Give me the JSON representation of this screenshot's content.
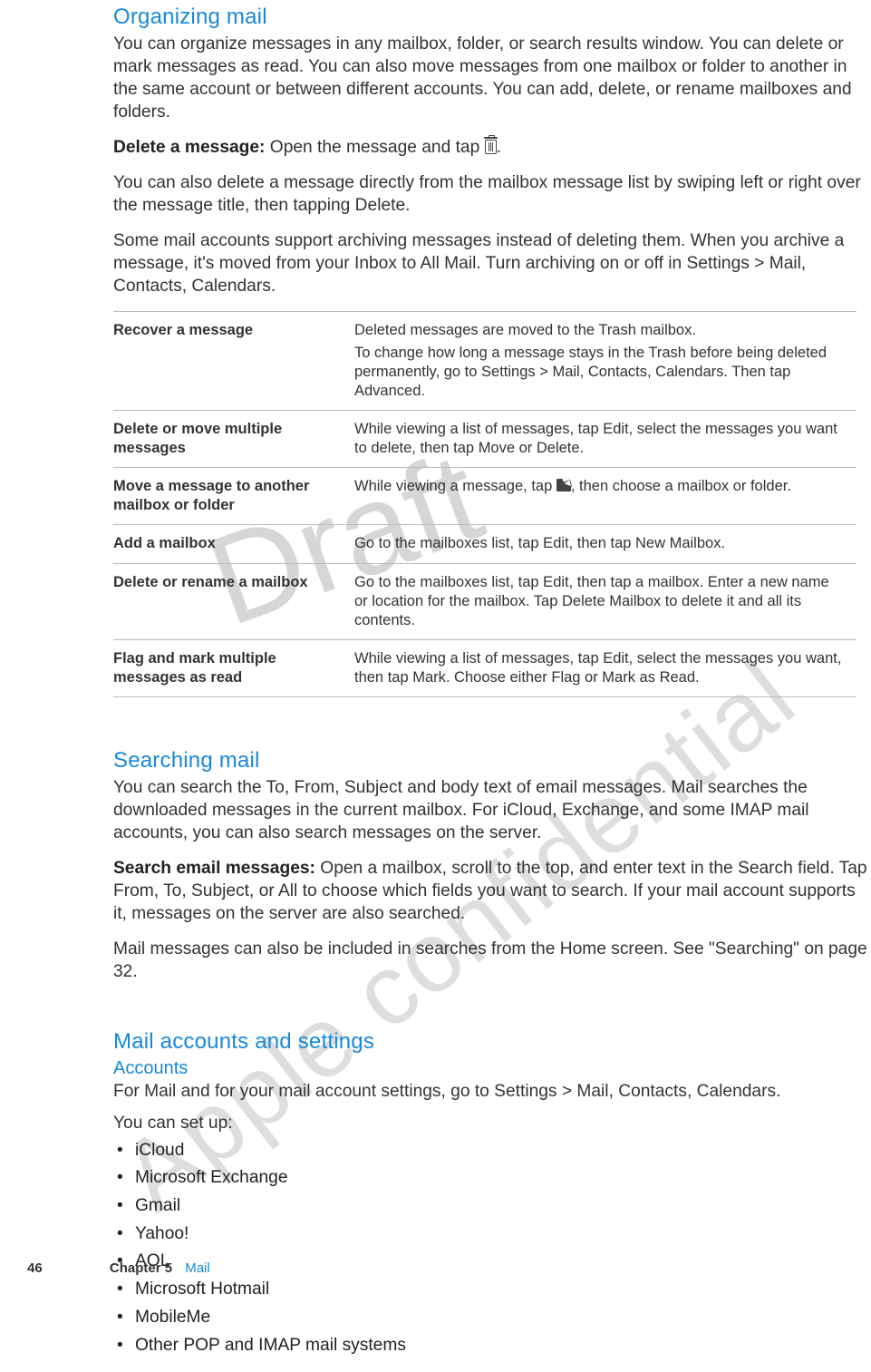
{
  "sections": {
    "organizing": {
      "title": "Organizing mail",
      "intro": "You can organize messages in any mailbox, folder, or search results window. You can delete or mark messages as read. You can also move messages from one mailbox or folder to another in the same account or between different accounts. You can add, delete, or rename mailboxes and folders.",
      "delete_label": "Delete a message:",
      "delete_body_a": "  Open the message and tap ",
      "delete_body_b": ".",
      "swipe": "You can also delete a message directly from the mailbox message list by swiping left or right over the message title, then tapping Delete.",
      "archive": "Some mail accounts support archiving messages instead of deleting them. When you archive a message, it's moved from your Inbox to All Mail. Turn archiving on or off in Settings > Mail, Contacts, Calendars."
    },
    "searching": {
      "title": "Searching mail",
      "intro": "You can search the To, From, Subject and body text of email messages. Mail searches the downloaded messages in the current mailbox. For iCloud, Exchange, and some IMAP mail accounts, you can also search messages on the server.",
      "search_label": "Search email messages:",
      "search_body": "  Open a mailbox, scroll to the top, and enter text in the Search field. Tap From, To, Subject, or All to choose which fields you want to search. If your mail account supports it, messages on the server are also searched.",
      "home": "Mail messages can also be included in searches from the Home screen. See \"Searching\" on page 32."
    },
    "settings": {
      "title": "Mail accounts and settings",
      "accounts_heading": "Accounts",
      "accounts_intro": "For Mail and for your mail account settings, go to Settings > Mail, Contacts, Calendars.",
      "setup_lead": "You can set up:",
      "account_types": [
        "iCloud",
        "Microsoft Exchange",
        "Gmail",
        "Yahoo!",
        "AOL",
        "Microsoft Hotmail",
        "MobileMe",
        "Other POP and IMAP mail systems"
      ]
    }
  },
  "table": [
    {
      "left": "Recover a message",
      "right": [
        "Deleted messages are moved to the Trash mailbox.",
        "To change how long a message stays in the Trash before being deleted permanently, go to Settings > Mail, Contacts, Calendars. Then tap Advanced."
      ]
    },
    {
      "left": "Delete or move multiple messages",
      "right": [
        "While viewing a list of messages, tap Edit, select the messages you want to delete, then tap Move or Delete."
      ]
    },
    {
      "left": "Move a message to another mailbox or folder",
      "right_a": "While viewing a message, tap ",
      "right_b": ", then choose a mailbox or folder."
    },
    {
      "left": "Add a mailbox",
      "right": [
        "Go to the mailboxes list, tap Edit, then tap New Mailbox."
      ]
    },
    {
      "left": "Delete or rename a mailbox",
      "right": [
        "Go to the mailboxes list, tap Edit, then tap a mailbox. Enter a new name or location for the mailbox. Tap Delete Mailbox to delete it and all its contents."
      ]
    },
    {
      "left": "Flag and mark multiple messages as read",
      "right": [
        "While viewing a list of messages, tap Edit, select the messages you want, then tap Mark. Choose either Flag or Mark as Read."
      ]
    }
  ],
  "watermarks": {
    "draft": "Draft",
    "confidential": "Apple confidential"
  },
  "footer": {
    "page": "46",
    "chapter": "Chapter 5",
    "title": "Mail"
  }
}
